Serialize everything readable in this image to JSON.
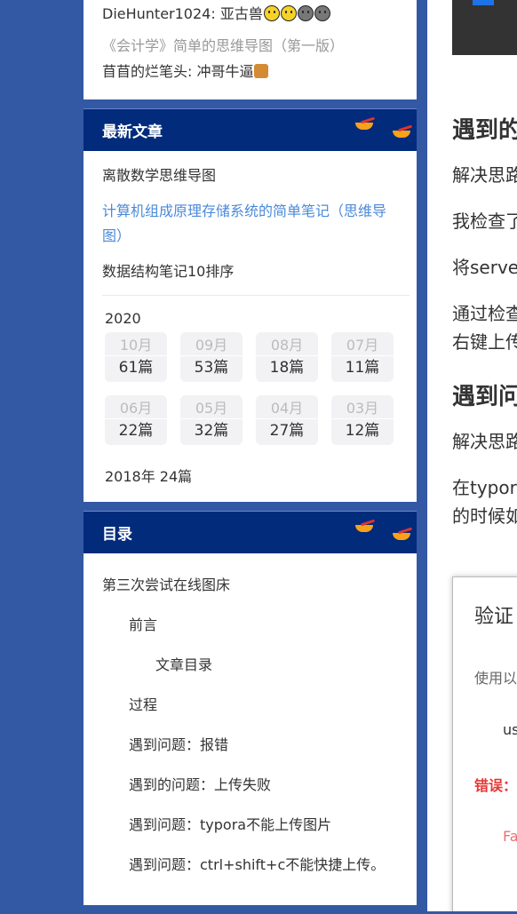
{
  "comments": [
    {
      "text": "DieHunter1024: 亚古兽",
      "emojis": [
        "smile",
        "smile",
        "dark",
        "dark"
      ]
    },
    {
      "text": "《会计学》简单的思维导图（第一版）"
    },
    {
      "text": "苜苜的烂笔头: 冲哥牛逼",
      "emojis": [
        "beer"
      ]
    }
  ],
  "latest": {
    "title": "最新文章",
    "articles": [
      "离散数学思维导图",
      "计算机组成原理存储系统的简单笔记（思维导图）",
      "数据结构笔记10排序"
    ]
  },
  "archive": {
    "year": "2020",
    "months": [
      {
        "m": "10月",
        "c": "61篇"
      },
      {
        "m": "09月",
        "c": "53篇"
      },
      {
        "m": "08月",
        "c": "18篇"
      },
      {
        "m": "07月",
        "c": "11篇"
      },
      {
        "m": "06月",
        "c": "22篇"
      },
      {
        "m": "05月",
        "c": "32篇"
      },
      {
        "m": "04月",
        "c": "27篇"
      },
      {
        "m": "03月",
        "c": "12篇"
      }
    ],
    "older": "2018年  24篇"
  },
  "toc": {
    "title": "目录",
    "items": [
      {
        "text": "第三次尝试在线图床",
        "level": 1
      },
      {
        "text": "前言",
        "level": 2
      },
      {
        "text": "文章目录",
        "level": 3
      },
      {
        "text": "过程",
        "level": 2
      },
      {
        "text": "遇到问题：报错",
        "level": 2
      },
      {
        "text": "遇到的问题：上传失败",
        "level": 2
      },
      {
        "text": "遇到问题：typora不能上传图片",
        "level": 2
      },
      {
        "text": "遇到问题：ctrl+shift+c不能快捷上传。",
        "level": 2
      }
    ]
  },
  "main": {
    "heading1": "遇到的",
    "p1": "解决思路",
    "p2": "我检查了",
    "p3": "将serve",
    "p4a": "通过检查",
    "p4b": "右键上传",
    "heading2": "遇到问",
    "p5": "解决思路",
    "p6a": "在typor",
    "p6b": "的时候如",
    "dialog": {
      "title": "验证",
      "sub": "使用以",
      "us": "us",
      "err": "错误：",
      "fa": "Fa"
    }
  },
  "colors": {
    "page_bg": "#3358a4",
    "header_bg": "#022b7c",
    "link": "#4b8ad9"
  }
}
